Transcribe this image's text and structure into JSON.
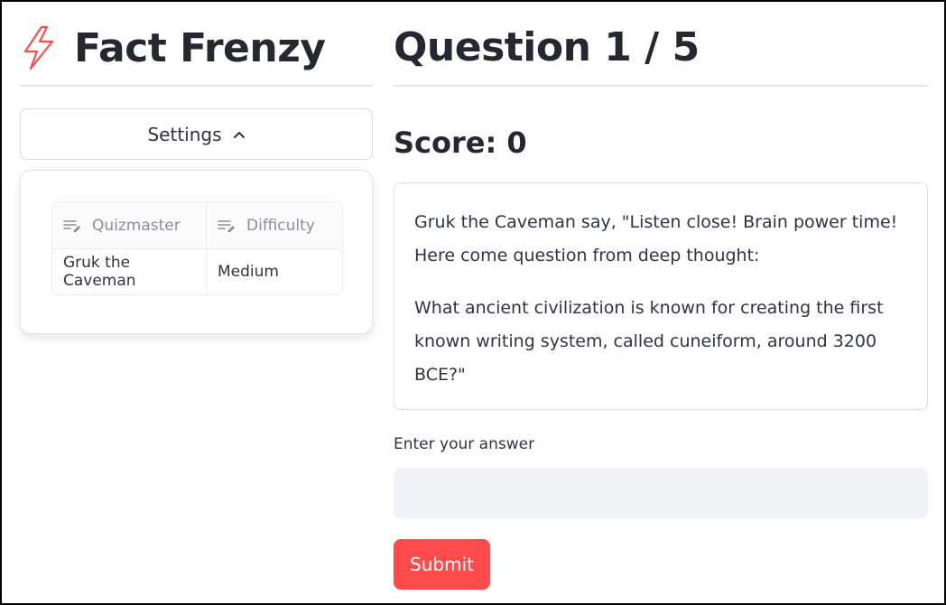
{
  "app": {
    "title": "Fact Frenzy",
    "icon": "lightning-bolt-icon",
    "accent_color": "#ff4b4b"
  },
  "sidebar": {
    "settings_label": "Settings",
    "settings_expanded": true,
    "table": {
      "headers": [
        "Quizmaster",
        "Difficulty"
      ],
      "header_icon": "edit-column-icon",
      "rows": [
        [
          "Gruk the Caveman",
          "Medium"
        ]
      ]
    }
  },
  "main": {
    "question_heading": "Question 1 / 5",
    "score_text": "Score: 0",
    "question_paragraphs": [
      "Gruk the Caveman say, \"Listen close! Brain power time! Here come question from deep thought:",
      "What ancient civilization is known for creating the first known writing system, called cuneiform, around 3200 BCE?\""
    ],
    "answer_label": "Enter your answer",
    "answer_value": "",
    "answer_placeholder": "",
    "submit_label": "Submit"
  }
}
